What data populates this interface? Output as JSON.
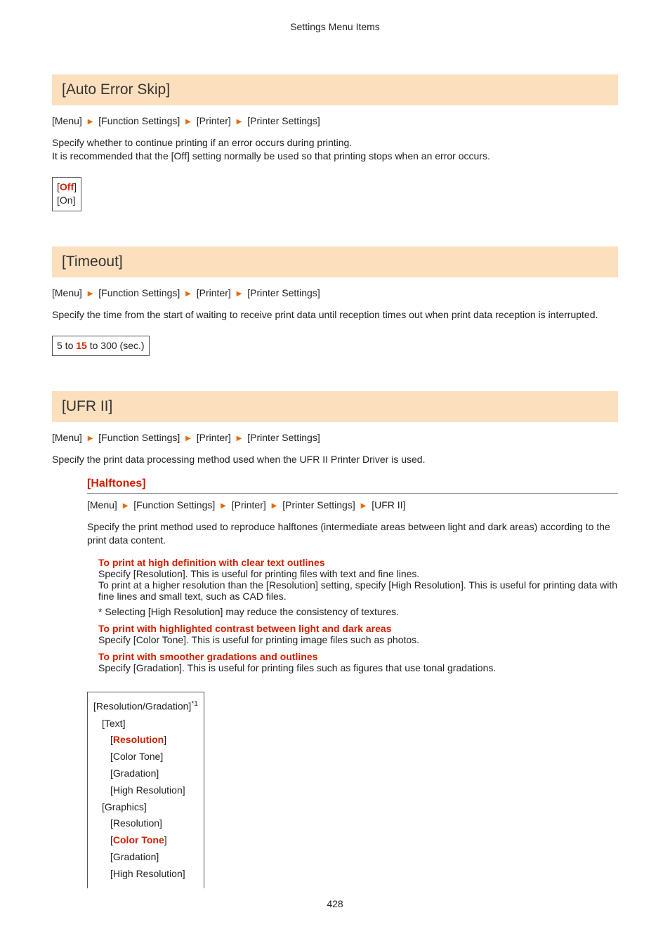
{
  "header": "Settings Menu Items",
  "sections": {
    "autoErrorSkip": {
      "title": "[Auto Error Skip]",
      "breadcrumb": [
        "[Menu]",
        "[Function Settings]",
        "[Printer]",
        "[Printer Settings]"
      ],
      "desc": "Specify whether to continue printing if an error occurs during printing.\nIt is recommended that the [Off] setting normally be used so that printing stops when an error occurs.",
      "options": {
        "off_open": "[",
        "off": "Off",
        "off_close": "]",
        "on": "[On]"
      }
    },
    "timeout": {
      "title": "[Timeout]",
      "breadcrumb": [
        "[Menu]",
        "[Function Settings]",
        "[Printer]",
        "[Printer Settings]"
      ],
      "desc": "Specify the time from the start of waiting to receive print data until reception times out when print data reception is interrupted.",
      "range": {
        "pre": "5 to ",
        "def": "15",
        "post": " to 300 (sec.)"
      }
    },
    "ufr": {
      "title": "[UFR II]",
      "breadcrumb": [
        "[Menu]",
        "[Function Settings]",
        "[Printer]",
        "[Printer Settings]"
      ],
      "desc": "Specify the print data processing method used when the UFR II Printer Driver is used.",
      "halftones": {
        "heading": "[Halftones]",
        "breadcrumb": [
          "[Menu]",
          "[Function Settings]",
          "[Printer]",
          "[Printer Settings]",
          "[UFR II]"
        ],
        "intro": "Specify the print method used to reproduce halftones (intermediate areas between light and dark areas) according to the print data content.",
        "p1head": "To print at high definition with clear text outlines",
        "p1l1": "Specify [Resolution]. This is useful for printing files with text and fine lines.",
        "p1l2": "To print at a higher resolution than the [Resolution] setting, specify [High Resolution]. This is useful for printing data with fine lines and small text, such as CAD files.",
        "p1note": "* Selecting [High Resolution] may reduce the consistency of textures.",
        "p2head": "To print with highlighted contrast between light and dark areas",
        "p2l1": "Specify [Color Tone]. This is useful for printing image files such as photos.",
        "p3head": "To print with smoother gradations and outlines",
        "p3l1": "Specify [Gradation]. This is useful for printing files such as figures that use tonal gradations.",
        "table": {
          "rg": "[Resolution/Gradation]",
          "sup": "*1",
          "text": "[Text]",
          "res_open": "[",
          "res": "Resolution",
          "res_close": "]",
          "ct": "[Color Tone]",
          "grad": "[Gradation]",
          "hires": "[High Resolution]",
          "graphics": "[Graphics]",
          "gres": "[Resolution]",
          "gct_open": "[",
          "gct": "Color Tone",
          "gct_close": "]",
          "ggrad": "[Gradation]",
          "ghires": "[High Resolution]"
        }
      }
    }
  },
  "pageno": "428"
}
